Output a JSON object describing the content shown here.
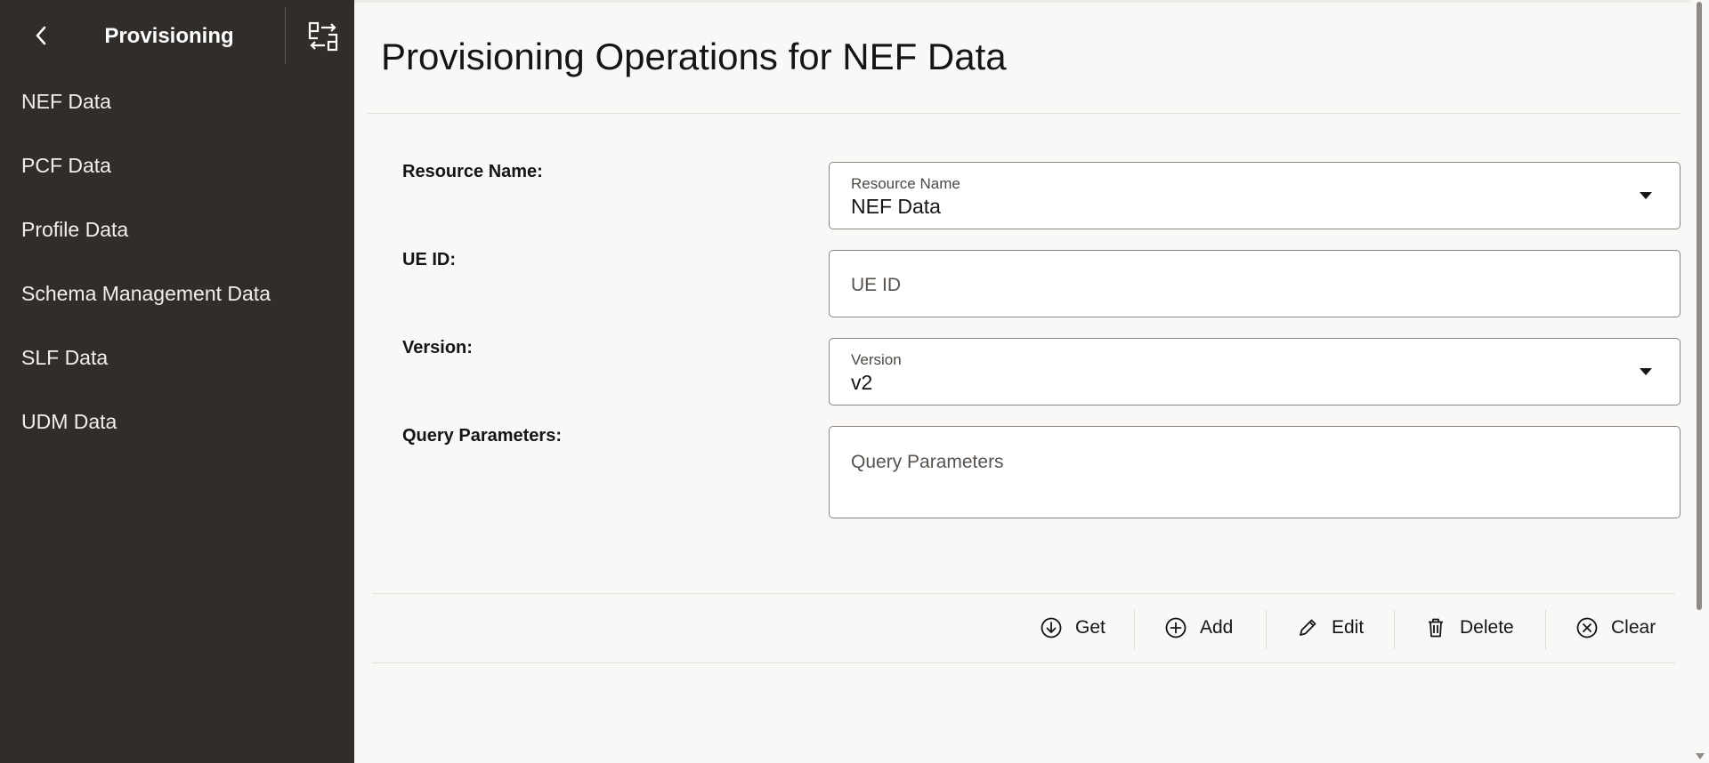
{
  "sidebar": {
    "title": "Provisioning",
    "items": [
      {
        "label": "NEF Data"
      },
      {
        "label": "PCF Data"
      },
      {
        "label": "Profile Data"
      },
      {
        "label": "Schema Management Data"
      },
      {
        "label": "SLF Data"
      },
      {
        "label": "UDM Data"
      }
    ]
  },
  "main": {
    "title": "Provisioning Operations for NEF Data",
    "form": {
      "resource_name": {
        "label": "Resource Name:",
        "field_label": "Resource Name",
        "value": "NEF Data"
      },
      "ue_id": {
        "label": "UE ID:",
        "placeholder": "UE ID"
      },
      "version": {
        "label": "Version:",
        "field_label": "Version",
        "value": "v2"
      },
      "query_parameters": {
        "label": "Query Parameters:",
        "placeholder": "Query Parameters"
      }
    },
    "actions": {
      "get": "Get",
      "add": "Add",
      "edit": "Edit",
      "delete": "Delete",
      "clear": "Clear"
    }
  },
  "colors": {
    "sidebar_bg": "#312d2a",
    "page_bg": "#f9f8f6"
  }
}
